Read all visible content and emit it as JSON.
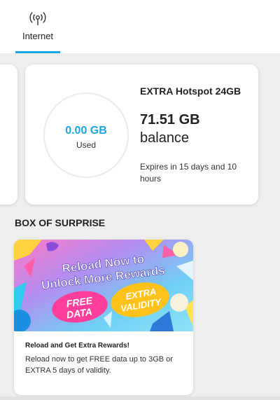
{
  "tabs": [
    {
      "label": "Internet",
      "icon": "signal-broadcast-icon",
      "active": true
    }
  ],
  "plan": {
    "name": "EXTRA Hotspot 24GB",
    "used_value": "0.00 GB",
    "used_label": "Used",
    "balance_amount": "71.51 GB",
    "balance_label": "balance",
    "expiry": "Expires in 15 days and 10 hours"
  },
  "section": {
    "title": "BOX OF SURPRISE"
  },
  "promo": {
    "banner_headline_line1": "Reload Now to",
    "banner_headline_line2": "Unlock More Rewards",
    "banner_badge_left_line1": "FREE",
    "banner_badge_left_line2": "DATA",
    "banner_badge_right_line1": "EXTRA",
    "banner_badge_right_line2": "VALIDITY",
    "title": "Reload and Get Extra Rewards!",
    "description": "Reload now to get FREE data up to 3GB or EXTRA 5 days of validity."
  },
  "colors": {
    "accent": "#1aa6e4",
    "background": "#eeeeee",
    "card": "#ffffff"
  }
}
